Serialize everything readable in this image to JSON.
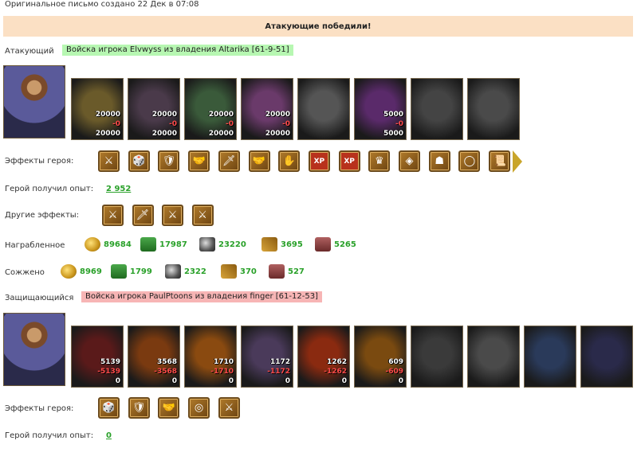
{
  "header": {
    "original_created": "Оригинальное письмо создано 22 Дек в 07:08"
  },
  "banner": {
    "result": "Атакующие победили!"
  },
  "attacker": {
    "label": "Атакующий",
    "army": "Войска игрока Elvwyss из владения Altarika [61-9-51]",
    "units": [
      {
        "top": "20000",
        "loss": "-0",
        "bottom": "20000",
        "color": "#6a5a2a",
        "name": "unit-beast"
      },
      {
        "top": "20000",
        "loss": "-0",
        "bottom": "20000",
        "color": "#4a3a4a",
        "name": "unit-dark-warrior"
      },
      {
        "top": "20000",
        "loss": "-0",
        "bottom": "20000",
        "color": "#3a5a3a",
        "name": "unit-lizard-knight"
      },
      {
        "top": "20000",
        "loss": "-0",
        "bottom": "20000",
        "color": "#6a3a6a",
        "name": "unit-harpy"
      },
      {
        "top": "",
        "loss": "",
        "bottom": "",
        "color": "#555555",
        "name": "unit-archer-grey"
      },
      {
        "top": "5000",
        "loss": "-0",
        "bottom": "5000",
        "color": "#5a2a6a",
        "name": "unit-sorceress"
      },
      {
        "top": "",
        "loss": "",
        "bottom": "",
        "color": "#444444",
        "name": "unit-reaper-grey"
      },
      {
        "top": "",
        "loss": "",
        "bottom": "",
        "color": "#4a4a4a",
        "name": "unit-spider-grey"
      }
    ],
    "effects_label": "Эффекты героя:",
    "effects": [
      "⚔",
      "🎲",
      "🛡",
      "🤝",
      "🗡",
      "🤝",
      "✋",
      "XP",
      "XP",
      "♛",
      "◈",
      "☗",
      "◯",
      "📜"
    ],
    "exp_label": "Герой получил опыт:",
    "exp_value": "2 952",
    "other_label": "Другие эффекты:",
    "other_effects": [
      "⚔",
      "🗡",
      "⚔",
      "⚔"
    ],
    "loot_label": "Награбленное",
    "loot": [
      "89684",
      "17987",
      "23220",
      "3695",
      "5265"
    ],
    "burned_label": "Сожжено",
    "burned": [
      "8969",
      "1799",
      "2322",
      "370",
      "527"
    ]
  },
  "defender": {
    "label": "Защищающийся",
    "army": "Войска игрока PaulPtoons из владения finger [61-12-53]",
    "units": [
      {
        "top": "5139",
        "loss": "-5139",
        "bottom": "0",
        "color": "#5a1a1a",
        "name": "unit-red-demon"
      },
      {
        "top": "3568",
        "loss": "-3568",
        "bottom": "0",
        "color": "#7a3a10",
        "name": "unit-fire-skeleton"
      },
      {
        "top": "1710",
        "loss": "-1710",
        "bottom": "0",
        "color": "#8a4a10",
        "name": "unit-fire-hound"
      },
      {
        "top": "1172",
        "loss": "-1172",
        "bottom": "0",
        "color": "#4a3a5a",
        "name": "unit-gargoyle"
      },
      {
        "top": "1262",
        "loss": "-1262",
        "bottom": "0",
        "color": "#8a2a10",
        "name": "unit-lava-golem"
      },
      {
        "top": "609",
        "loss": "-609",
        "bottom": "0",
        "color": "#7a4a10",
        "name": "unit-fire-ogre"
      },
      {
        "top": "",
        "loss": "",
        "bottom": "",
        "color": "#3a3a3a",
        "name": "unit-demon-grey"
      },
      {
        "top": "",
        "loss": "",
        "bottom": "",
        "color": "#4a4a4a",
        "name": "unit-wraith-grey"
      },
      {
        "top": "",
        "loss": "",
        "bottom": "",
        "color": "#2a3a5a",
        "name": "unit-tower"
      },
      {
        "top": "",
        "loss": "",
        "bottom": "",
        "color": "#2a2a4a",
        "name": "unit-spire"
      }
    ],
    "effects_label": "Эффекты героя:",
    "effects": [
      "🎲",
      "🛡",
      "🤝",
      "◎",
      "⚔"
    ],
    "exp_label": "Герой получил опыт:",
    "exp_value": "0"
  },
  "resource_icons": [
    "gold-coins-icon",
    "wood-icon",
    "ore-icon",
    "grain-icon",
    "brick-icon"
  ]
}
